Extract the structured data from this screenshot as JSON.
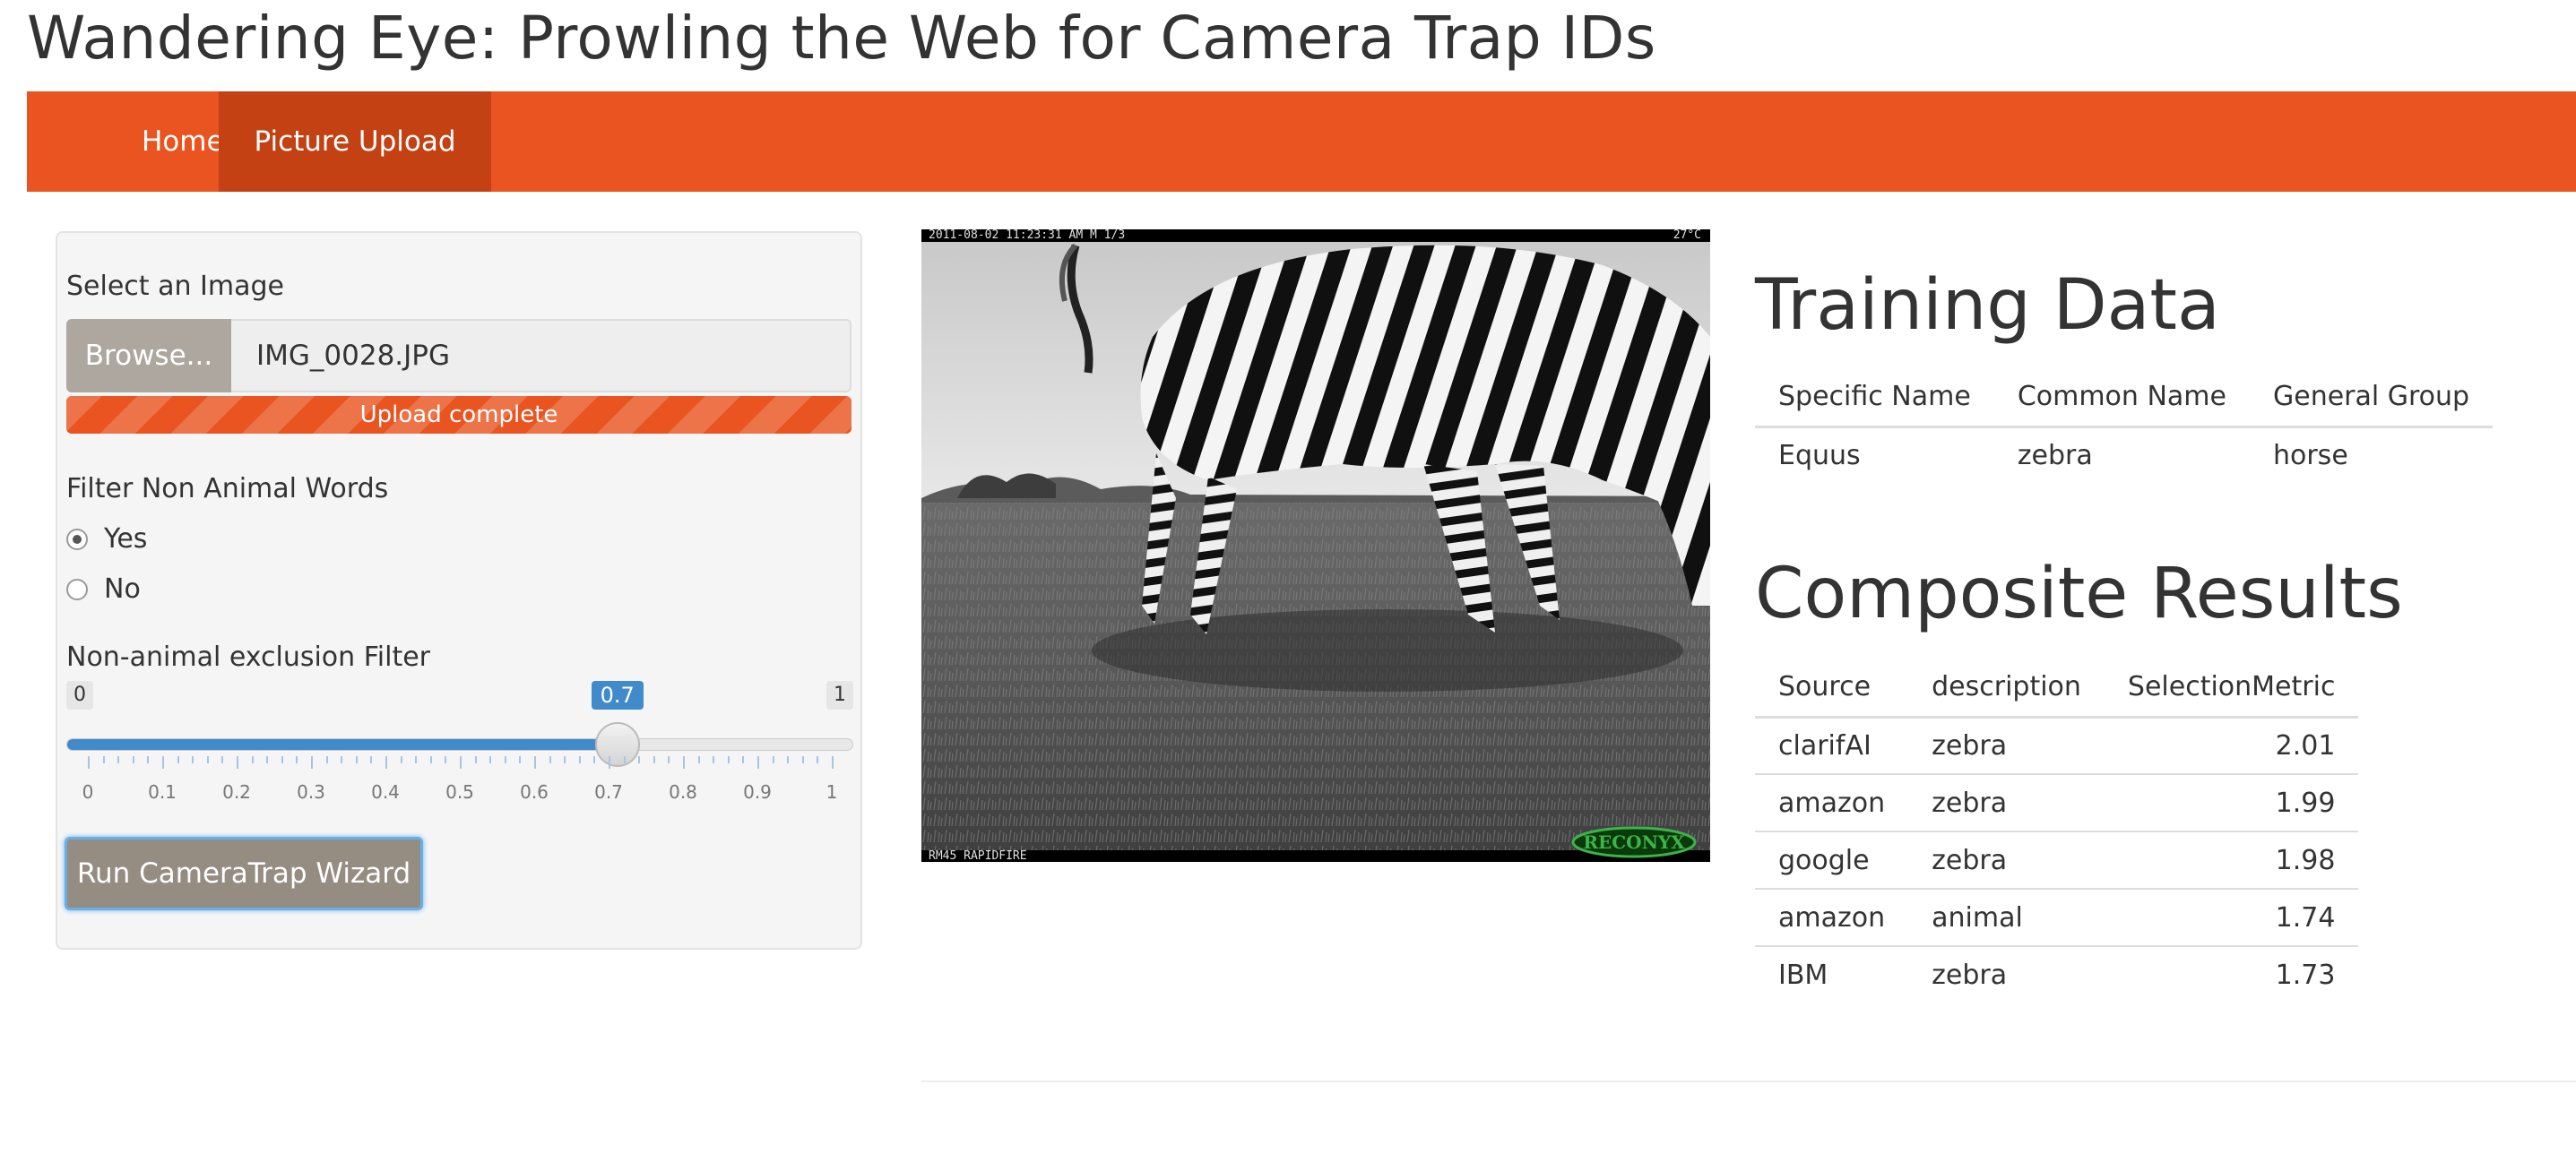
{
  "app": {
    "title": "Wandering Eye: Prowling the Web for Camera Trap IDs"
  },
  "nav": {
    "tabs": [
      {
        "label": "Home"
      },
      {
        "label": "Picture Upload"
      }
    ]
  },
  "sidebar": {
    "file_input": {
      "label": "Select an Image",
      "browse_label": "Browse...",
      "value": "IMG_0028.JPG",
      "progress_text": "Upload complete",
      "progress": 1.0
    },
    "filter": {
      "label": "Filter Non Animal Words",
      "options": [
        {
          "label": "Yes",
          "selected": true
        },
        {
          "label": "No",
          "selected": false
        }
      ]
    },
    "slider": {
      "label": "Non-animal exclusion Filter",
      "min": 0,
      "max": 1,
      "value": 0.7,
      "min_label": "0",
      "max_label": "1",
      "value_label": "0.7",
      "ticks": [
        "0",
        "0.1",
        "0.2",
        "0.3",
        "0.4",
        "0.5",
        "0.6",
        "0.7",
        "0.8",
        "0.9",
        "1"
      ]
    },
    "run_button": "Run CameraTrap Wizard"
  },
  "photo": {
    "stamp_top_left": "2011-08-02 11:23:31 AM  M 1/3",
    "stamp_top_right": "27°C",
    "stamp_bottom_left": "RM45 RAPIDFIRE",
    "logo": "RECONYX"
  },
  "training": {
    "heading": "Training Data",
    "headers": [
      "Specific Name",
      "Common Name",
      "General Group"
    ],
    "rows": [
      [
        "Equus",
        "zebra",
        "horse"
      ]
    ]
  },
  "composite": {
    "heading": "Composite Results",
    "headers": [
      "Source",
      "description",
      "SelectionMetric"
    ],
    "rows": [
      [
        "clarifAI",
        "zebra",
        "2.01"
      ],
      [
        "amazon",
        "zebra",
        "1.99"
      ],
      [
        "google",
        "zebra",
        "1.98"
      ],
      [
        "amazon",
        "animal",
        "1.74"
      ],
      [
        "IBM",
        "zebra",
        "1.73"
      ]
    ]
  },
  "colors": {
    "navbar": "#e95420",
    "navbar_active": "#c34113",
    "slider_accent": "#428bca",
    "button": "#958c82"
  }
}
